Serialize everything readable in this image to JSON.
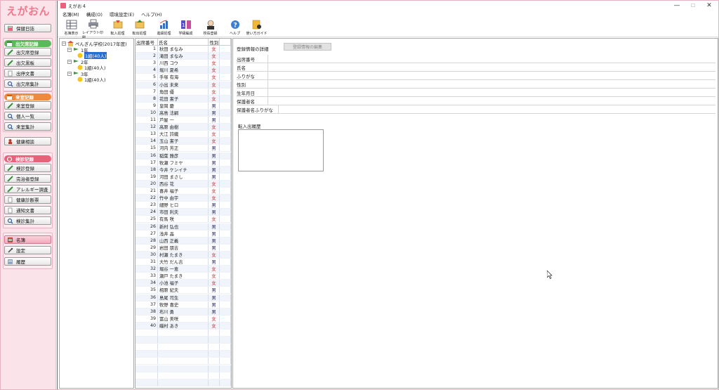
{
  "sidebar": {
    "logo": "えがおん",
    "hoken_nisshi": "保健日誌",
    "shukketsu_section": "出欠席記録",
    "shukketsu_touroku": "出欠席登録",
    "shukketsu_kokuban": "出欠黒板",
    "shutei_bunsho": "出停文書",
    "shukketsu_shukei": "出欠席集計",
    "raishitsu_section": "来室記録",
    "raishitsu_touroku": "来室登録",
    "kojin_ichiran": "個人一覧",
    "raishitsu_shukei": "来室集計",
    "kenkou_soudan": "健康相談",
    "kenshin_section": "検診記録",
    "kenshin_touroku": "検診登録",
    "kanchisha_touroku": "完治者登録",
    "allergy_chousa": "アレルギー調査",
    "kenkou_shindansho": "健康診断票",
    "tsuuchi_bunsho": "通知文書",
    "kenshin_shukei": "検診集計",
    "meibo": "名簿",
    "settei": "設定",
    "rireki": "履歴"
  },
  "window": {
    "title": "えがお４",
    "min": "—",
    "max": "☐",
    "close": "✕"
  },
  "menu": [
    "名簿(M)",
    "構成(O)",
    "環境設定(E)",
    "ヘルプ(H)"
  ],
  "toolbar": [
    {
      "label": "名簿表示",
      "icon": "list-icon"
    },
    {
      "label": "レイアウト印刷",
      "icon": "printer-icon"
    },
    {
      "label": "転入処理",
      "icon": "transfer-in-icon"
    },
    {
      "label": "転出処理",
      "icon": "transfer-out-icon"
    },
    {
      "label": "進級処理",
      "icon": "chart-icon"
    },
    {
      "label": "学級編成",
      "icon": "class-icon"
    },
    {
      "label": "校長登録",
      "icon": "principal-icon"
    },
    {
      "label": "ヘルプ",
      "icon": "help-icon"
    },
    {
      "label": "使い方ガイド",
      "icon": "guide-icon"
    }
  ],
  "tree": {
    "school": "ぺんぎん学校(2017年度)",
    "grades": [
      {
        "grade": "1年",
        "cls": "1組(40人)"
      },
      {
        "grade": "2年",
        "cls": "1組(40人)"
      },
      {
        "grade": "3年",
        "cls": "1組(40人)"
      }
    ]
  },
  "grid": {
    "headers": [
      "出席番号",
      "氏名",
      "性別"
    ],
    "rows": [
      {
        "no": "1",
        "name": "秋田 まなみ",
        "sex": "女"
      },
      {
        "no": "2",
        "name": "滝田 まなみ",
        "sex": "女"
      },
      {
        "no": "3",
        "name": "川西 コウ",
        "sex": "女"
      },
      {
        "no": "4",
        "name": "堀川 夏希",
        "sex": "女"
      },
      {
        "no": "5",
        "name": "手塚 有海",
        "sex": "女"
      },
      {
        "no": "6",
        "name": "小出 未来",
        "sex": "女"
      },
      {
        "no": "7",
        "name": "角田 優",
        "sex": "女"
      },
      {
        "no": "8",
        "name": "花田 憲子",
        "sex": "女"
      },
      {
        "no": "9",
        "name": "皇岡 慶",
        "sex": "男"
      },
      {
        "no": "10",
        "name": "高島 法嗣",
        "sex": "男"
      },
      {
        "no": "11",
        "name": "芦屋 一",
        "sex": "男"
      },
      {
        "no": "12",
        "name": "高原 由樹",
        "sex": "女"
      },
      {
        "no": "13",
        "name": "大江 詩織",
        "sex": "女"
      },
      {
        "no": "14",
        "name": "玉山 憲子",
        "sex": "女"
      },
      {
        "no": "15",
        "name": "河内 芳正",
        "sex": "男"
      },
      {
        "no": "16",
        "name": "稲葉 雅彦",
        "sex": "男"
      },
      {
        "no": "17",
        "name": "牧瀬 フミヤ",
        "sex": "男"
      },
      {
        "no": "18",
        "name": "今井 ケンイチ",
        "sex": "男"
      },
      {
        "no": "19",
        "name": "河田 まさし",
        "sex": "男"
      },
      {
        "no": "20",
        "name": "西谷 花",
        "sex": "女"
      },
      {
        "no": "21",
        "name": "喜井 福子",
        "sex": "女"
      },
      {
        "no": "22",
        "name": "竹中 由宇",
        "sex": "女"
      },
      {
        "no": "23",
        "name": "細野 ヒロ",
        "sex": "男"
      },
      {
        "no": "24",
        "name": "市田 利夫",
        "sex": "男"
      },
      {
        "no": "25",
        "name": "有馬 咲",
        "sex": "女"
      },
      {
        "no": "26",
        "name": "新村 弘也",
        "sex": "男"
      },
      {
        "no": "27",
        "name": "浅井 晶",
        "sex": "男"
      },
      {
        "no": "28",
        "name": "山西 正義",
        "sex": "男"
      },
      {
        "no": "29",
        "name": "岩田 朋吉",
        "sex": "男"
      },
      {
        "no": "30",
        "name": "村瀬 たまき",
        "sex": "女"
      },
      {
        "no": "31",
        "name": "大竹 だん吉",
        "sex": "男"
      },
      {
        "no": "32",
        "name": "堀谷 一恵",
        "sex": "女"
      },
      {
        "no": "33",
        "name": "瀬戸 たまき",
        "sex": "女"
      },
      {
        "no": "34",
        "name": "小池 福子",
        "sex": "女"
      },
      {
        "no": "35",
        "name": "相原 紀夫",
        "sex": "男"
      },
      {
        "no": "36",
        "name": "島尾 司生",
        "sex": "男"
      },
      {
        "no": "37",
        "name": "牧野 喜史",
        "sex": "男"
      },
      {
        "no": "38",
        "name": "布川 勇",
        "sex": "男"
      },
      {
        "no": "39",
        "name": "冨山 美咲",
        "sex": "女"
      },
      {
        "no": "40",
        "name": "磯村 あき",
        "sex": "女"
      }
    ]
  },
  "detail": {
    "title": "登録情報の詳細",
    "edit_button": "登録情報の編集",
    "fields": [
      "出席番号",
      "氏名",
      "ふりがな",
      "性別",
      "生年月日",
      "保護者名",
      "保護者名ふりがな"
    ],
    "history_label": "転入出履歴"
  },
  "colors": {
    "accent_pink": "#f2788c",
    "section_green": "#5cb85c",
    "section_orange": "#f08a3a",
    "section_pink": "#e8627a",
    "female": "#d22222",
    "male": "#222255"
  }
}
